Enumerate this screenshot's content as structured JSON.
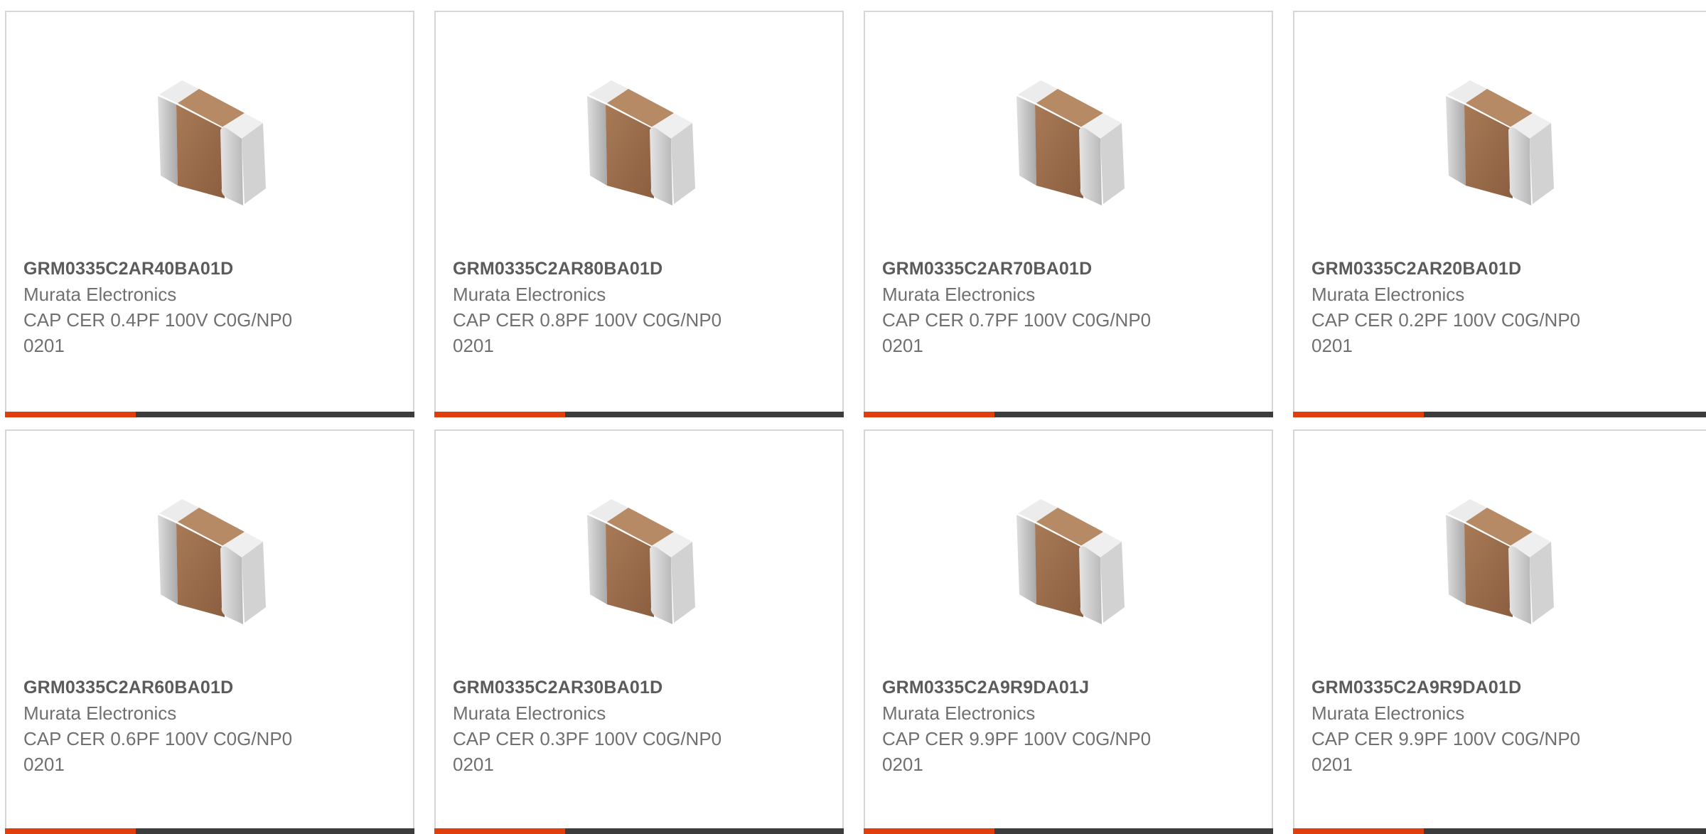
{
  "accent_color": "#e03f0d",
  "bar_color": "#3c3c3c",
  "products": [
    {
      "part": "GRM0335C2AR40BA01D",
      "manufacturer": "Murata Electronics",
      "description": "CAP CER 0.4PF 100V C0G/NP0\n0201",
      "image_icon": "capacitor-chip-image"
    },
    {
      "part": "GRM0335C2AR80BA01D",
      "manufacturer": "Murata Electronics",
      "description": "CAP CER 0.8PF 100V C0G/NP0\n0201",
      "image_icon": "capacitor-chip-image"
    },
    {
      "part": "GRM0335C2AR70BA01D",
      "manufacturer": "Murata Electronics",
      "description": "CAP CER 0.7PF 100V C0G/NP0\n0201",
      "image_icon": "capacitor-chip-image"
    },
    {
      "part": "GRM0335C2AR20BA01D",
      "manufacturer": "Murata Electronics",
      "description": "CAP CER 0.2PF 100V C0G/NP0\n0201",
      "image_icon": "capacitor-chip-image"
    },
    {
      "part": "GRM0335C2AR60BA01D",
      "manufacturer": "Murata Electronics",
      "description": "CAP CER 0.6PF 100V C0G/NP0\n0201",
      "image_icon": "capacitor-chip-image"
    },
    {
      "part": "GRM0335C2AR30BA01D",
      "manufacturer": "Murata Electronics",
      "description": "CAP CER 0.3PF 100V C0G/NP0\n0201",
      "image_icon": "capacitor-chip-image"
    },
    {
      "part": "GRM0335C2A9R9DA01J",
      "manufacturer": "Murata Electronics",
      "description": "CAP CER 9.9PF 100V C0G/NP0\n0201",
      "image_icon": "capacitor-chip-image"
    },
    {
      "part": "GRM0335C2A9R9DA01D",
      "manufacturer": "Murata Electronics",
      "description": "CAP CER 9.9PF 100V C0G/NP0\n0201",
      "image_icon": "capacitor-chip-image"
    }
  ]
}
